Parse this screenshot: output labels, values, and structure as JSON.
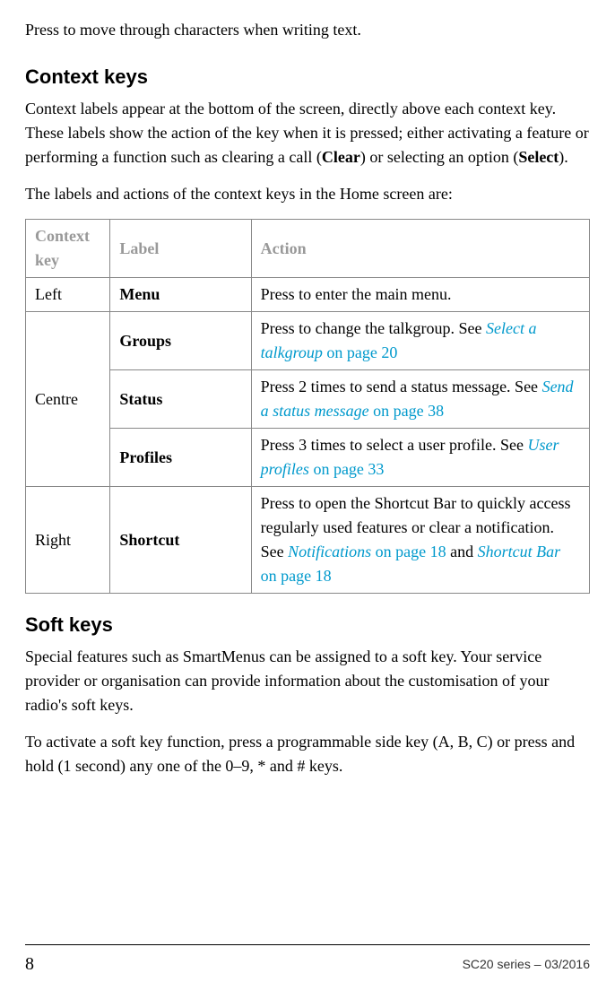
{
  "intro": "Press to move through characters when writing text.",
  "section1": {
    "heading": "Context keys",
    "p1_a": "Context labels appear at the bottom of the screen, directly above each context key. These labels show the action of the key when it is pressed; either activating a feature or performing a function such as clearing a call (",
    "p1_clear": "Clear",
    "p1_b": ") or selecting an option (",
    "p1_select": "Select",
    "p1_c": ").",
    "p2": "The labels and actions of the context keys in the Home screen are:"
  },
  "table": {
    "h1": "Context key",
    "h2": "Label",
    "h3": "Action",
    "r1": {
      "key": "Left",
      "label": "Menu",
      "action": "Press to enter the main menu."
    },
    "r2": {
      "key": "Centre",
      "label": "Groups",
      "action_pre": "Press to change the talkgroup. See ",
      "link": "Select a talkgroup",
      "action_post": " on page 20"
    },
    "r3": {
      "label": "Status",
      "action_pre": "Press 2 times to send a status message. See ",
      "link": "Send a status message",
      "action_post": " on page 38"
    },
    "r4": {
      "label": "Profiles",
      "action_pre": "Press 3 times to select a user profile. See ",
      "link": "User profiles ",
      "action_post": " on page 33"
    },
    "r5": {
      "key": "Right",
      "label": "Shortcut",
      "action_pre": "Press to open the Shortcut Bar to quickly access regularly used features or clear a notification. See ",
      "link1": "Notifications",
      "mid1": " on page 18",
      "and": " and ",
      "link2": "Shortcut Bar",
      "mid2": " on page 18"
    }
  },
  "section2": {
    "heading": "Soft keys",
    "p1": "Special features such as SmartMenus can be assigned to a soft key. Your service provider or organisation can provide information about the customisation of your radio's soft keys.",
    "p2": "To activate a soft key function, press a programmable side key (A, B, C) or press and hold (1 second) any one of the 0–9, * and # keys."
  },
  "footer": {
    "page": "8",
    "series": "SC20 series – 03/2016"
  }
}
